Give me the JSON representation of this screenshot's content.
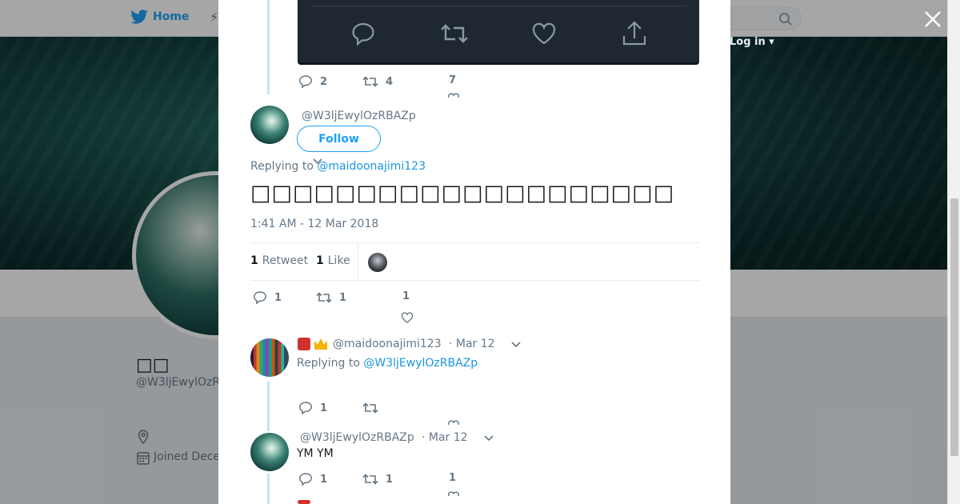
{
  "topbar": {
    "home_label": "Home",
    "login_label": "Log in ▾"
  },
  "profile": {
    "name": "□□",
    "handle": "@W3ljEwylOzR",
    "joined": "Joined Dece"
  },
  "modal": {
    "prev_tweet_actions": {
      "replies": "2",
      "retweets": "4",
      "likes": "7"
    },
    "main_tweet": {
      "handle": "@W3ljEwylOzRBAZp",
      "follow_label": "Follow",
      "replying_prefix": "Replying to ",
      "replying_to": "@maidoonajimi123",
      "text": "□□□□□□□□□□□□□□□□□□□□",
      "timestamp": "1:41 AM - 12 Mar 2018",
      "retweet_count": "1",
      "retweet_label": "Retweet",
      "like_count": "1",
      "like_label": "Like",
      "actions": {
        "replies": "1",
        "retweets": "1",
        "likes": "1"
      }
    },
    "replies": [
      {
        "handle": "@maidoonajimi123",
        "date": "· Mar 12",
        "replying_prefix": "Replying to ",
        "replying_to": "@W3ljEwylOzRBAZp",
        "actions": {
          "replies": "1"
        }
      },
      {
        "handle": "@W3ljEwylOzRBAZp",
        "date": "· Mar 12",
        "text": "YM YM",
        "actions": {
          "replies": "1",
          "retweets": "1",
          "likes": "1"
        }
      }
    ]
  },
  "colors": {
    "accent": "#1da1f2",
    "link": "#1b95e0",
    "muted": "#657786",
    "thread": "#c3e5f6",
    "media_bg": "#1e2732"
  }
}
